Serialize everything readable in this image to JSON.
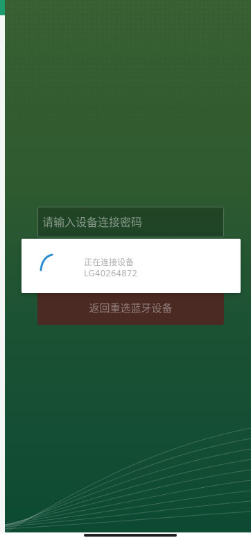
{
  "password_placeholder": "请输入设备连接密码",
  "reselect_label": "返回重选蓝牙设备",
  "dialog": {
    "title": "正在连接设备",
    "device_name": "LG40264872"
  },
  "colors": {
    "accent": "#1f9c6e",
    "spinner": "#2f8fd0",
    "button_bg": "#4a2a22"
  },
  "icons": {
    "spinner": "loading-spinner-icon"
  }
}
